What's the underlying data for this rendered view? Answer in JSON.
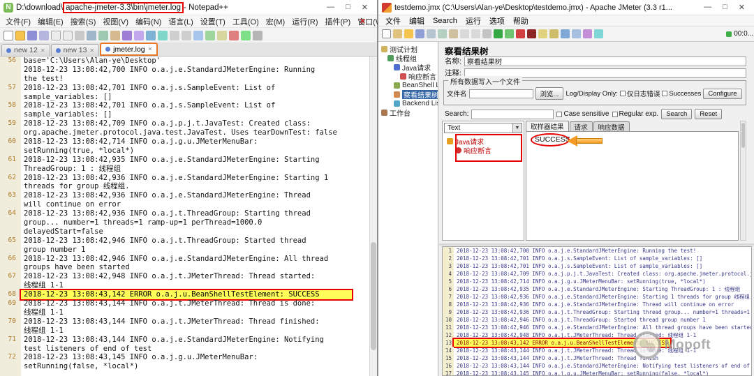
{
  "annotation_color": "#e60000",
  "npp": {
    "app_icon_glyph": "N",
    "title_prefix": "D:\\download\\",
    "title_highlight": "apache-jmeter-3.3\\bin\\jmeter.log",
    "title_suffix": " - Notepad++",
    "window_buttons": [
      {
        "name": "minimize-button",
        "glyph": "—"
      },
      {
        "name": "maximize-button",
        "glyph": "□"
      },
      {
        "name": "close-button",
        "glyph": "✕"
      }
    ],
    "menu_items": [
      "文件(F)",
      "编辑(E)",
      "搜索(S)",
      "视图(V)",
      "编码(N)",
      "语言(L)",
      "设置(T)",
      "工具(O)",
      "宏(M)",
      "运行(R)",
      "插件(P)",
      "窗口(W)",
      "?"
    ],
    "menu_close_glyph": "✕",
    "toolbar_icons": [
      "new-file-icon",
      "open-folder-icon",
      "save-icon",
      "save-all-icon",
      "close-icon",
      "close-all-icon",
      "print-icon",
      "cut-icon",
      "copy-icon",
      "paste-icon",
      "undo-icon",
      "redo-icon",
      "find-icon",
      "replace-icon",
      "zoom-in-icon",
      "zoom-out-icon",
      "sync-scroll-icon",
      "word-wrap-icon",
      "show-symbols-icon",
      "macro-record-icon",
      "macro-play-icon",
      "function-list-icon"
    ],
    "tabs": [
      {
        "label": "new 12",
        "close_glyph": "✕"
      },
      {
        "label": "new 13",
        "close_glyph": "✕"
      },
      {
        "label": "jmeter.log",
        "close_glyph": "✕",
        "active": true
      }
    ],
    "editor_rows": [
      {
        "num": "56",
        "text": "base='C:\\Users\\Alan-ye\\Desktop'"
      },
      {
        "text": "2018-12-23 13:08:42,700 INFO o.a.j.e.StandardJMeterEngine: Running"
      },
      {
        "text": "the test!"
      },
      {
        "num": "57",
        "text": "2018-12-23 13:08:42,701 INFO o.a.j.s.SampleEvent: List of"
      },
      {
        "text": "sample_variables: []"
      },
      {
        "num": "58",
        "text": "2018-12-23 13:08:42,701 INFO o.a.j.s.SampleEvent: List of"
      },
      {
        "text": "sample_variables: []"
      },
      {
        "num": "59",
        "text": "2018-12-23 13:08:42,709 INFO o.a.j.p.j.t.JavaTest: Created class:"
      },
      {
        "text": "org.apache.jmeter.protocol.java.test.JavaTest. Uses tearDownTest: false"
      },
      {
        "num": "60",
        "text": "2018-12-23 13:08:42,714 INFO o.a.j.g.u.JMeterMenuBar:"
      },
      {
        "text": "setRunning(true, *local*)"
      },
      {
        "num": "61",
        "text": "2018-12-23 13:08:42,935 INFO o.a.j.e.StandardJMeterEngine: Starting"
      },
      {
        "text": "ThreadGroup: 1 : 线程组"
      },
      {
        "num": "62",
        "text": "2018-12-23 13:08:42,936 INFO o.a.j.e.StandardJMeterEngine: Starting 1"
      },
      {
        "text": "threads for group 线程组."
      },
      {
        "num": "63",
        "text": "2018-12-23 13:08:42,936 INFO o.a.j.e.StandardJMeterEngine: Thread"
      },
      {
        "text": "will continue on error"
      },
      {
        "num": "64",
        "text": "2018-12-23 13:08:42,936 INFO o.a.j.t.ThreadGroup: Starting thread"
      },
      {
        "text": "group... number=1 threads=1 ramp-up=1 perThread=1000.0"
      },
      {
        "text": "delayedStart=false"
      },
      {
        "num": "65",
        "text": "2018-12-23 13:08:42,946 INFO o.a.j.t.ThreadGroup: Started thread"
      },
      {
        "text": "group number 1"
      },
      {
        "num": "66",
        "text": "2018-12-23 13:08:42,946 INFO o.a.j.e.StandardJMeterEngine: All thread"
      },
      {
        "text": "groups have been started"
      },
      {
        "num": "67",
        "text": "2018-12-23 13:08:42,948 INFO o.a.j.t.JMeterThread: Thread started:"
      },
      {
        "text": "线程组 1-1"
      },
      {
        "num": "68",
        "text": "2018-12-23 13:08:43,142 ERROR o.a.j.u.BeanShellTestElement: SUCCESS",
        "highlight": true
      },
      {
        "num": "69",
        "text": "2018-12-23 13:08:43,144 INFO o.a.j.t.JMeterThread: Thread is done:"
      },
      {
        "text": "线程组 1-1"
      },
      {
        "num": "70",
        "text": "2018-12-23 13:08:43,144 INFO o.a.j.t.JMeterThread: Thread finished:"
      },
      {
        "text": "线程组 1-1"
      },
      {
        "num": "71",
        "text": "2018-12-23 13:08:43,144 INFO o.a.j.e.StandardJMeterEngine: Notifying"
      },
      {
        "text": "test listeners of end of test"
      },
      {
        "num": "72",
        "text": "2018-12-23 13:08:43,145 INFO o.a.j.g.u.JMeterMenuBar:"
      },
      {
        "text": "setRunning(false, *local*)"
      }
    ]
  },
  "jmeter": {
    "title": "testdemo.jmx (C:\\Users\\Alan-ye\\Desktop\\testdemo.jmx) - Apache JMeter (3.3 r1...",
    "window_buttons": [
      {
        "name": "minimize-button",
        "glyph": "—"
      },
      {
        "name": "maximize-button",
        "glyph": "□"
      },
      {
        "name": "close-button",
        "glyph": "✕"
      }
    ],
    "menu_items": [
      "文件",
      "编辑",
      "Search",
      "运行",
      "选项",
      "帮助"
    ],
    "toolbar_icons": [
      "new-plan-icon",
      "templates-icon",
      "open-file-icon",
      "save-plan-icon",
      "cut-icon",
      "copy-icon",
      "paste-icon",
      "expand-tree-icon",
      "collapse-tree-icon",
      "toggle-icon",
      "start-icon",
      "start-no-pause-icon",
      "stop-icon",
      "shutdown-icon",
      "clear-icon",
      "clear-all-icon",
      "toolbar-search-icon",
      "search-reset-icon",
      "function-helper-icon",
      "help-icon"
    ],
    "timer_text": "00:0...",
    "tree_items": [
      {
        "label": "测试计划",
        "level": 0,
        "icon": "test-plan"
      },
      {
        "label": "线程组",
        "level": 1,
        "icon": "thread-group"
      },
      {
        "label": "Java请求",
        "level": 2,
        "icon": "java-request"
      },
      {
        "label": "响应断言",
        "level": 3,
        "icon": "assertion"
      },
      {
        "label": "BeanShell Listen...",
        "level": 2,
        "icon": "beanshell"
      },
      {
        "label": "察看结果树",
        "level": 2,
        "icon": "results-tree",
        "selected": true
      },
      {
        "label": "Backend Listen...",
        "level": 2,
        "icon": "backend"
      },
      {
        "label": "工作台",
        "level": 0,
        "icon": "workbench"
      }
    ],
    "panel": {
      "title": "察看结果树",
      "name_label": "名称:",
      "name_value": "察看结果树",
      "comment_label": "注释:",
      "comment_value": "",
      "file_group_title": "所有数据写入一个文件",
      "filename_label": "文件名",
      "filename_value": "",
      "browse_button": "浏览...",
      "log_display_label": "Log/Display Only:",
      "errors_only_checkbox": "仅日志错误",
      "successes_checkbox": "Successes",
      "configure_button": "Configure",
      "search_label": "Search:",
      "search_value": "",
      "case_sensitive_checkbox": "Case sensitive",
      "regular_exp_checkbox": "Regular exp.",
      "search_button": "Search",
      "reset_button": "Reset",
      "render_mode": "Text",
      "result_tree_items": [
        {
          "label": "Java请求",
          "level": 0,
          "icon": "sample-warning"
        },
        {
          "label": "响应断言",
          "level": 1,
          "icon": "assertion-failure"
        }
      ],
      "result_tabs": [
        {
          "label": "取样器结果",
          "active": true
        },
        {
          "label": "请求"
        },
        {
          "label": "响应数据"
        }
      ],
      "response_text": "SUCCESS"
    },
    "log_rows": [
      {
        "num": "1",
        "text": "2018-12-23 13:08:42,700 INFO o.a.j.e.StandardJMeterEngine: Running the test!"
      },
      {
        "num": "2",
        "text": "2018-12-23 13:08:42,701 INFO o.a.j.s.SampleEvent: List of sample_variables: []"
      },
      {
        "num": "3",
        "text": "2018-12-23 13:08:42,701 INFO o.a.j.s.SampleEvent: List of sample_variables: []"
      },
      {
        "num": "4",
        "text": "2018-12-23 13:08:42,709 INFO o.a.j.p.j.t.JavaTest: Created class: org.apache.jmeter.protocol.java.test.Jav"
      },
      {
        "num": "5",
        "text": "2018-12-23 13:08:42,714 INFO o.a.j.g.u.JMeterMenuBar: setRunning(true, *local*)"
      },
      {
        "num": "6",
        "text": "2018-12-23 13:08:42,935 INFO o.a.j.e.StandardJMeterEngine: Starting ThreadGroup: 1 : 线程组"
      },
      {
        "num": "7",
        "text": "2018-12-23 13:08:42,936 INFO o.a.j.e.StandardJMeterEngine: Starting 1 threads for group 线程组."
      },
      {
        "num": "8",
        "text": "2018-12-23 13:08:42,936 INFO o.a.j.e.StandardJMeterEngine: Thread will continue on error"
      },
      {
        "num": "9",
        "text": "2018-12-23 13:08:42,936 INFO o.a.j.t.ThreadGroup: Starting thread group... number=1 threads=1 ramp-up=1 pe"
      },
      {
        "num": "10",
        "text": "2018-12-23 13:08:42,946 INFO o.a.j.t.ThreadGroup: Started thread group number 1"
      },
      {
        "num": "11",
        "text": "2018-12-23 13:08:42,946 INFO o.a.j.e.StandardJMeterEngine: All thread groups have been started"
      },
      {
        "num": "12",
        "text": "2018-12-23 13:08:42,948 INFO o.a.j.t.JMeterThread: Thread started: 线程组 1-1"
      },
      {
        "num": "13",
        "text": "2018-12-23 13:08:43,142 ERROR o.a.j.u.BeanShellTestElement: SUCCESS",
        "highlight": true
      },
      {
        "num": "14",
        "text": "2018-12-23 13:08:43,144 INFO o.a.j.t.JMeterThread: Thread is done: 线程组 1-1"
      },
      {
        "num": "15",
        "text": "2018-12-23 13:08:43,144 INFO o.a.j.t.JMeterThread: Thread finish"
      },
      {
        "num": "16",
        "text": "2018-12-23 13:08:43,144 INFO o.a.j.e.StandardJMeterEngine: Notifying test listeners of end of test"
      },
      {
        "num": "17",
        "text": "2018-12-23 13:08:43,145 INFO o.a.j.g.u.JMeterMenuBar: setRunning(false, *local*)"
      }
    ],
    "watermark_text": "Mopoft"
  }
}
